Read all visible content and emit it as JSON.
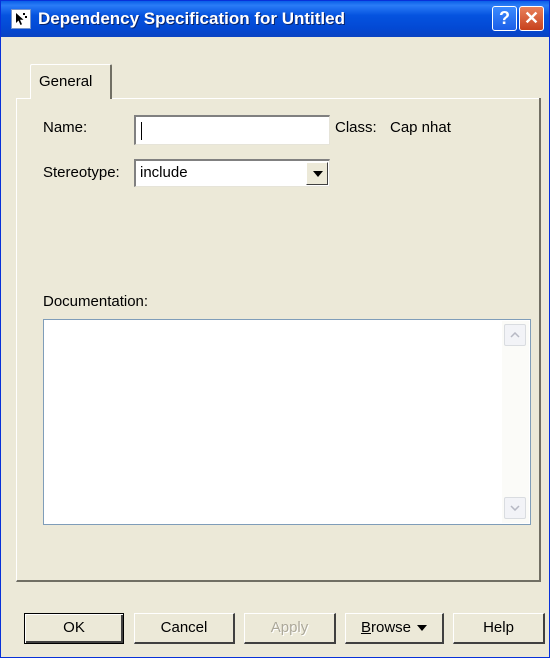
{
  "window": {
    "title": "Dependency Specification for Untitled",
    "help_glyph": "?",
    "close_glyph": "✕"
  },
  "tabs": [
    {
      "label": "General",
      "selected": true
    }
  ],
  "form": {
    "name_label": "Name:",
    "name_value": "",
    "class_label": "Class:",
    "class_value": "Cap nhat",
    "stereotype_label": "Stereotype:",
    "stereotype_value": "include",
    "documentation_label": "Documentation:",
    "documentation_value": ""
  },
  "buttons": {
    "ok": "OK",
    "cancel": "Cancel",
    "apply": "Apply",
    "browse_rest": "rowse",
    "browse_mnemonic": "B",
    "help": "Help"
  },
  "icons": [
    "specification-icon",
    "help-icon",
    "close-icon",
    "chevron-down-icon",
    "scroll-up-icon",
    "scroll-down-icon"
  ]
}
